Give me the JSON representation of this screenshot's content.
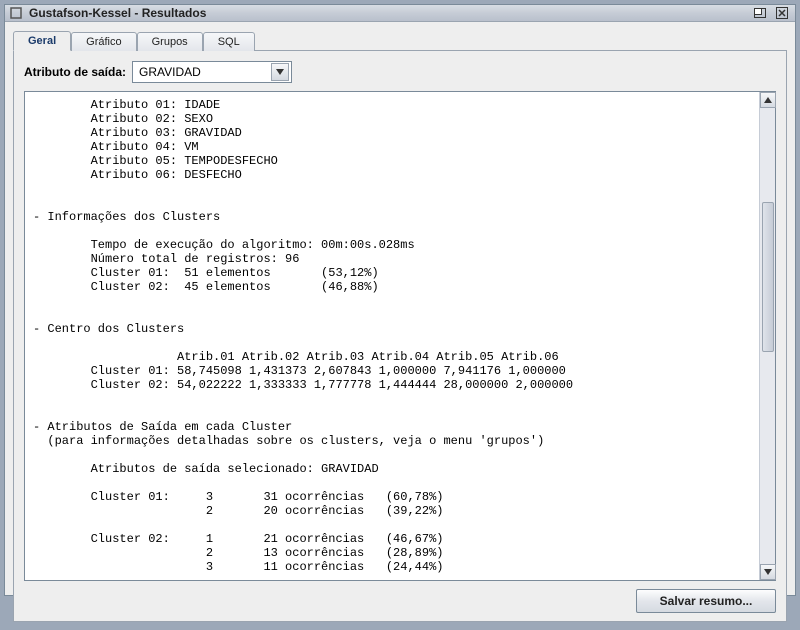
{
  "window": {
    "title": "Gustafson-Kessel - Resultados"
  },
  "tabs": {
    "items": [
      {
        "label": "Geral",
        "active": true
      },
      {
        "label": "Gráfico",
        "active": false
      },
      {
        "label": "Grupos",
        "active": false
      },
      {
        "label": "SQL",
        "active": false
      }
    ]
  },
  "attribute_selector": {
    "label": "Atributo de saída:",
    "value": "GRAVIDAD"
  },
  "report": {
    "attributes_header_prefix": "Atributo",
    "attributes": [
      {
        "index": "01",
        "name": "IDADE"
      },
      {
        "index": "02",
        "name": "SEXO"
      },
      {
        "index": "03",
        "name": "GRAVIDAD"
      },
      {
        "index": "04",
        "name": "VM"
      },
      {
        "index": "05",
        "name": "TEMPODESFECHO"
      },
      {
        "index": "06",
        "name": "DESFECHO"
      }
    ],
    "clusters_info": {
      "title": "- Informações dos Clusters",
      "runtime_label": "Tempo de execução do algoritmo:",
      "runtime_value": "00m:00s.028ms",
      "records_label": "Número total de registros:",
      "records_value": "96",
      "clusters": [
        {
          "id": "01",
          "count": "51",
          "unit": "elementos",
          "pct": "(53,12%)"
        },
        {
          "id": "02",
          "count": "45",
          "unit": "elementos",
          "pct": "(46,88%)"
        }
      ]
    },
    "centers": {
      "title": "- Centro dos Clusters",
      "header": [
        "Atrib.01",
        "Atrib.02",
        "Atrib.03",
        "Atrib.04",
        "Atrib.05",
        "Atrib.06"
      ],
      "rows": [
        {
          "id": "01",
          "values": [
            "58,745098",
            "1,431373",
            "2,607843",
            "1,000000",
            "7,941176",
            "1,000000"
          ]
        },
        {
          "id": "02",
          "values": [
            "54,022222",
            "1,333333",
            "1,777778",
            "1,444444",
            "28,000000",
            "2,000000"
          ]
        }
      ]
    },
    "output_attrs": {
      "title": "- Atributos de Saída em cada Cluster",
      "note": "(para informações detalhadas sobre os clusters, veja o menu 'grupos')",
      "selected_label": "Atributos de saída selecionado:",
      "selected_value": "GRAVIDAD",
      "clusters": [
        {
          "id": "01",
          "rows": [
            {
              "value": "3",
              "occ": "31",
              "occ_label": "ocorrências",
              "pct": "(60,78%)"
            },
            {
              "value": "2",
              "occ": "20",
              "occ_label": "ocorrências",
              "pct": "(39,22%)"
            }
          ]
        },
        {
          "id": "02",
          "rows": [
            {
              "value": "1",
              "occ": "21",
              "occ_label": "ocorrências",
              "pct": "(46,67%)"
            },
            {
              "value": "2",
              "occ": "13",
              "occ_label": "ocorrências",
              "pct": "(28,89%)"
            },
            {
              "value": "3",
              "occ": "11",
              "occ_label": "ocorrências",
              "pct": "(24,44%)"
            }
          ]
        }
      ]
    }
  },
  "buttons": {
    "save_summary": "Salvar resumo..."
  }
}
